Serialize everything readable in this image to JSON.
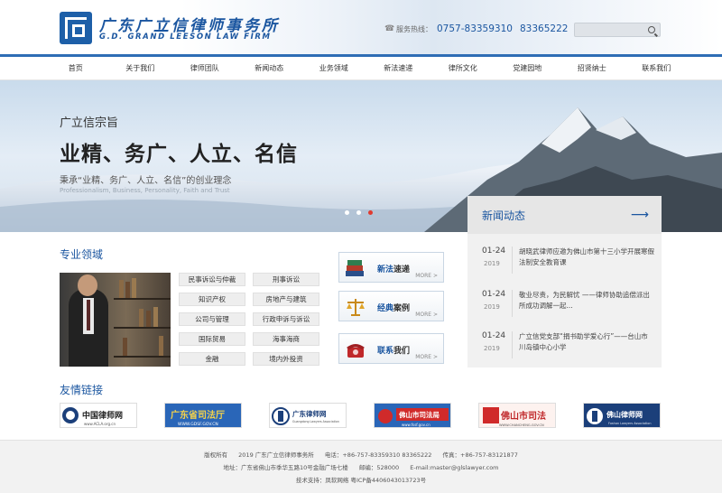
{
  "header": {
    "logo_cn": "广东广立信律师事务所",
    "logo_en": "G.D. GRAND LEESON LAW FIRM",
    "hotline_label": "服务热线：",
    "phone1": "0757-83359310",
    "phone2": "83365222",
    "search_placeholder": ""
  },
  "nav": [
    "首页",
    "关于我们",
    "律师团队",
    "新闻动态",
    "业务领域",
    "新法速递",
    "律所文化",
    "党建园地",
    "招贤纳士",
    "联系我们"
  ],
  "banner": {
    "small_title": "广立信宗旨",
    "big_title": "业精、务广、人立、名信",
    "subtitle": "秉承“业精、务广、人立、名信”的创业理念",
    "english": "Professionalism, Business, Personality, Faith and Trust"
  },
  "news": {
    "title": "新闻动态",
    "items": [
      {
        "date": "01-24",
        "year": "2019",
        "text": "胡晓武律师应邀为佛山市第十三小学开展寒假法制安全教育课"
      },
      {
        "date": "01-24",
        "year": "2019",
        "text": "敬业尽责，为民解忧 ——律师协助追偿派出所成功调解一起..."
      },
      {
        "date": "01-24",
        "year": "2019",
        "text": "广立信党支部“捐书助学爱心行”——台山市川岛镇中心小学"
      }
    ]
  },
  "practice": {
    "title": "专业领域",
    "items": [
      "民事诉讼与仲裁",
      "刑事诉讼",
      "知识产权",
      "房地产与建筑",
      "公司与管理",
      "行政申诉与诉讼",
      "国际贸易",
      "海事海商",
      "金融",
      "境内外投资"
    ]
  },
  "quick_links": [
    {
      "head": "新法",
      "tail": "速递",
      "more": "MORE >"
    },
    {
      "head": "经典",
      "tail": "案例",
      "more": "MORE >"
    },
    {
      "head": "联系",
      "tail": "我们",
      "more": "MORE >"
    }
  ],
  "friends": {
    "title": "友情链接",
    "logos": [
      {
        "label": "中国律师网",
        "sub": "www.ACLA.org.cn"
      },
      {
        "label": "广东省司法厅",
        "sub": "WWW.GDSF.GOV.CN"
      },
      {
        "label": "广东律师网",
        "sub": "Guangdong Lawyers Association"
      },
      {
        "label": "佛山市司法局",
        "sub": "www.fssf.gov.cn"
      },
      {
        "label": "佛山市司法",
        "sub": "WWW.CHANCHENG.GOV.CN"
      },
      {
        "label": "佛山律师网",
        "sub": "Foshan Lawyers Association"
      }
    ]
  },
  "footer": {
    "line1": [
      "版权所有",
      "2019 广东广立信律师事务所",
      "电话：+86-757-83359310   83365222",
      "传真：+86-757-83121877"
    ],
    "line2": [
      "地址：广东省佛山市季华五路10号金融广场七楼",
      "邮编：528000",
      "E-mail:master@glslawyer.com"
    ],
    "line3": "技术支持：凤软网络 粤ICP备4406043013723号"
  },
  "colors": {
    "brand": "#1b56a0",
    "accent_dot": "#e03a2f"
  }
}
